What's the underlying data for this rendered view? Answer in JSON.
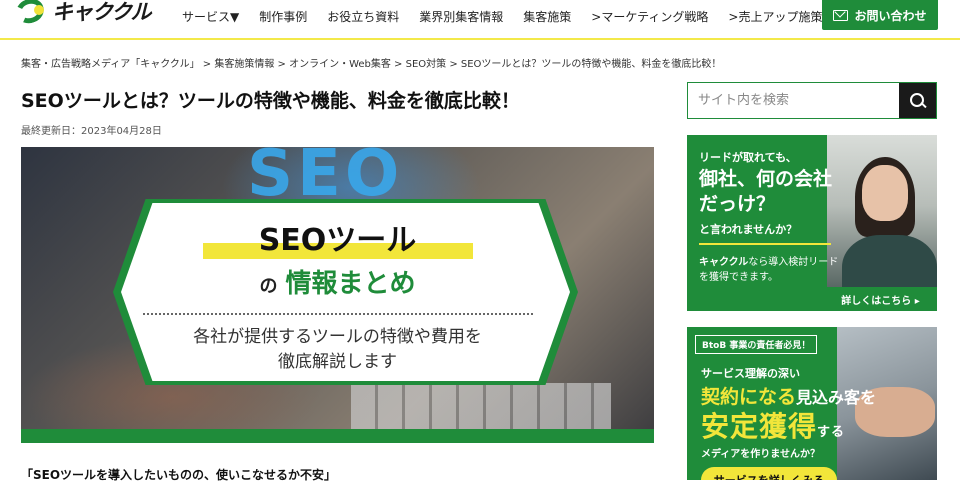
{
  "header": {
    "logo_text": "キャククル",
    "nav": [
      "サービス▼",
      "制作事例",
      "お役立ち資料",
      "業界別集客情報",
      "集客施策",
      ">マーケティング戦略",
      ">売上アップ施策"
    ],
    "contact_label": "お問い合わせ"
  },
  "breadcrumb": "集客・広告戦略メディア「キャククル」 > 集客施策情報 > オンライン・Web集客 > SEO対策 > SEOツールとは？ツールの特徴や機能、料金を徹底比較！",
  "article": {
    "title": "SEOツールとは？ツールの特徴や機能、料金を徹底比較！",
    "updated": "最終更新日：2023年04月28日",
    "intro": "「SEOツールを導入したいものの、使いこなせるか不安」"
  },
  "hero": {
    "bg_text": "SEO",
    "title": "SEOツール",
    "sub_no": "の",
    "sub": "情報まとめ",
    "desc1": "各社が提供するツールの特徴や費用を",
    "desc2": "徹底解説します"
  },
  "sidebar": {
    "search_placeholder": "サイト内を検索",
    "ad1": {
      "t1": "リードが取れても、",
      "t2": "御社、何の会社だっけ？",
      "t3": "と言われませんか？",
      "t4a": "キャククル",
      "t4b": "なら導入検討リード",
      "t4c": "を獲得できます。",
      "more": "詳しくはこちら ▸"
    },
    "ad2": {
      "tag": "BtoB 事業の責任者必見！",
      "t1": "サービス理解の深い",
      "t2a": "契約になる",
      "t2b": "見込み客を",
      "t3a": "安定獲得",
      "t3b": "する",
      "t4": "メディアを作りませんか？",
      "cta": "サービスを詳しくみる"
    }
  },
  "colors": {
    "brand_green": "#1f8c3a",
    "accent_yellow": "#f2e63a"
  }
}
